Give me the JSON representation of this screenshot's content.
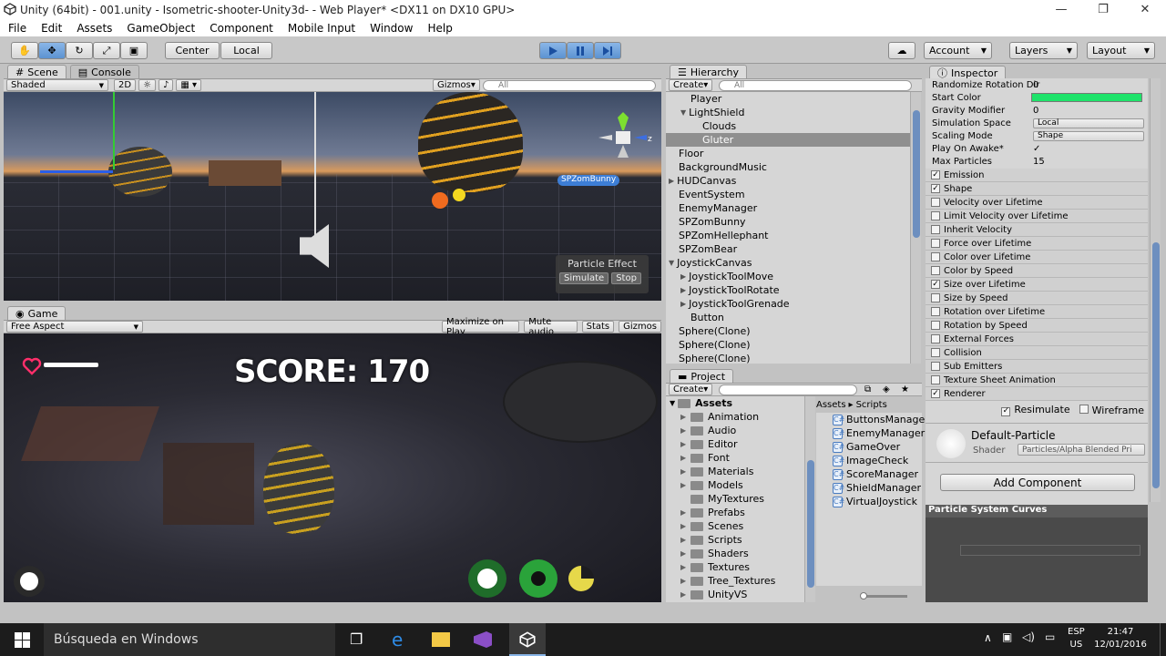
{
  "window": {
    "title": "Unity (64bit) - 001.unity - Isometric-shooter-Unity3d- - Web Player* <DX11 on DX10 GPU>",
    "minimize": "—",
    "maximize": "❐",
    "close": "✕"
  },
  "menu": [
    "File",
    "Edit",
    "Assets",
    "GameObject",
    "Component",
    "Mobile Input",
    "Window",
    "Help"
  ],
  "toolbar": {
    "center": "Center",
    "local": "Local",
    "account": "Account",
    "layers": "Layers",
    "layout": "Layout"
  },
  "scene": {
    "tab_scene": "Scene",
    "tab_console": "Console",
    "shaded": "Shaded",
    "mode_2d": "2D",
    "gizmos": "Gizmos",
    "search_placeholder": "All",
    "tag": "SPZomBunny",
    "particle_effect": "Particle Effect",
    "simulate": "Simulate",
    "stop": "Stop"
  },
  "game": {
    "tab": "Game",
    "aspect": "Free Aspect",
    "maximize": "Maximize on Play",
    "mute": "Mute audio",
    "stats": "Stats",
    "gizmos": "Gizmos",
    "score": "SCORE: 170"
  },
  "hierarchy": {
    "tab": "Hierarchy",
    "create": "Create",
    "search_placeholder": "All",
    "items": [
      {
        "label": "Player",
        "indent": 1,
        "arrow": "",
        "sel": false
      },
      {
        "label": "LightShield",
        "indent": 1,
        "arrow": "▼",
        "sel": false
      },
      {
        "label": "Clouds",
        "indent": 2,
        "arrow": "",
        "sel": false
      },
      {
        "label": "Gluter",
        "indent": 2,
        "arrow": "",
        "sel": true
      },
      {
        "label": "Floor",
        "indent": 0,
        "arrow": "",
        "sel": false
      },
      {
        "label": "BackgroundMusic",
        "indent": 0,
        "arrow": "",
        "sel": false
      },
      {
        "label": "HUDCanvas",
        "indent": 0,
        "arrow": "▶",
        "sel": false
      },
      {
        "label": "EventSystem",
        "indent": 0,
        "arrow": "",
        "sel": false
      },
      {
        "label": "EnemyManager",
        "indent": 0,
        "arrow": "",
        "sel": false
      },
      {
        "label": "SPZomBunny",
        "indent": 0,
        "arrow": "",
        "sel": false
      },
      {
        "label": "SPZomHellephant",
        "indent": 0,
        "arrow": "",
        "sel": false
      },
      {
        "label": "SPZomBear",
        "indent": 0,
        "arrow": "",
        "sel": false
      },
      {
        "label": "JoystickCanvas",
        "indent": 0,
        "arrow": "▼",
        "sel": false
      },
      {
        "label": "JoystickToolMove",
        "indent": 1,
        "arrow": "▶",
        "sel": false
      },
      {
        "label": "JoystickToolRotate",
        "indent": 1,
        "arrow": "▶",
        "sel": false
      },
      {
        "label": "JoystickToolGrenade",
        "indent": 1,
        "arrow": "▶",
        "sel": false
      },
      {
        "label": "Button",
        "indent": 1,
        "arrow": "",
        "sel": false
      },
      {
        "label": "Sphere(Clone)",
        "indent": 0,
        "arrow": "",
        "sel": false
      },
      {
        "label": "Sphere(Clone)",
        "indent": 0,
        "arrow": "",
        "sel": false
      },
      {
        "label": "Sphere(Clone)",
        "indent": 0,
        "arrow": "",
        "sel": false
      }
    ]
  },
  "project": {
    "tab": "Project",
    "create": "Create",
    "crumb_assets": "Assets",
    "crumb_scripts": "Scripts",
    "root": "Assets",
    "folders": [
      "Animation",
      "Audio",
      "Editor",
      "Font",
      "Materials",
      "Models",
      "MyTextures",
      "Prefabs",
      "Scenes",
      "Scripts",
      "Shaders",
      "Textures",
      "Tree_Textures",
      "UnityVS"
    ],
    "files": [
      "ButtonsManager",
      "EnemyManager",
      "GameOver",
      "ImageCheck",
      "ScoreManager",
      "ShieldManager",
      "VirtualJoystick"
    ]
  },
  "inspector": {
    "tab": "Inspector",
    "props": [
      {
        "label": "Randomize Rotation Dir",
        "value": "0"
      },
      {
        "label": "Start Color",
        "value": ""
      },
      {
        "label": "Gravity Modifier",
        "value": "0"
      },
      {
        "label": "Simulation Space",
        "value": "Local"
      },
      {
        "label": "Scaling Mode",
        "value": "Shape"
      },
      {
        "label": "Play On Awake*",
        "value": "✓"
      },
      {
        "label": "Max Particles",
        "value": "15"
      }
    ],
    "modules": [
      {
        "label": "Emission",
        "on": true
      },
      {
        "label": "Shape",
        "on": true
      },
      {
        "label": "Velocity over Lifetime",
        "on": false
      },
      {
        "label": "Limit Velocity over Lifetime",
        "on": false
      },
      {
        "label": "Inherit Velocity",
        "on": false
      },
      {
        "label": "Force over Lifetime",
        "on": false
      },
      {
        "label": "Color over Lifetime",
        "on": false
      },
      {
        "label": "Color by Speed",
        "on": false
      },
      {
        "label": "Size over Lifetime",
        "on": true
      },
      {
        "label": "Size by Speed",
        "on": false
      },
      {
        "label": "Rotation over Lifetime",
        "on": false
      },
      {
        "label": "Rotation by Speed",
        "on": false
      },
      {
        "label": "External Forces",
        "on": false
      },
      {
        "label": "Collision",
        "on": false
      },
      {
        "label": "Sub Emitters",
        "on": false
      },
      {
        "label": "Texture Sheet Animation",
        "on": false
      },
      {
        "label": "Renderer",
        "on": true
      }
    ],
    "resimulate": "Resimulate",
    "wireframe": "Wireframe",
    "material": "Default-Particle",
    "shader_label": "Shader",
    "shader": "Particles/Alpha Blended Pri",
    "add_component": "Add Component",
    "curves": "Particle System Curves"
  },
  "taskbar": {
    "search": "Búsqueda en Windows",
    "lang1": "ESP",
    "lang2": "US",
    "time": "21:47",
    "date": "12/01/2016"
  },
  "colors": {
    "start_color": "#1ee36a",
    "accent": "#5c93d1"
  }
}
